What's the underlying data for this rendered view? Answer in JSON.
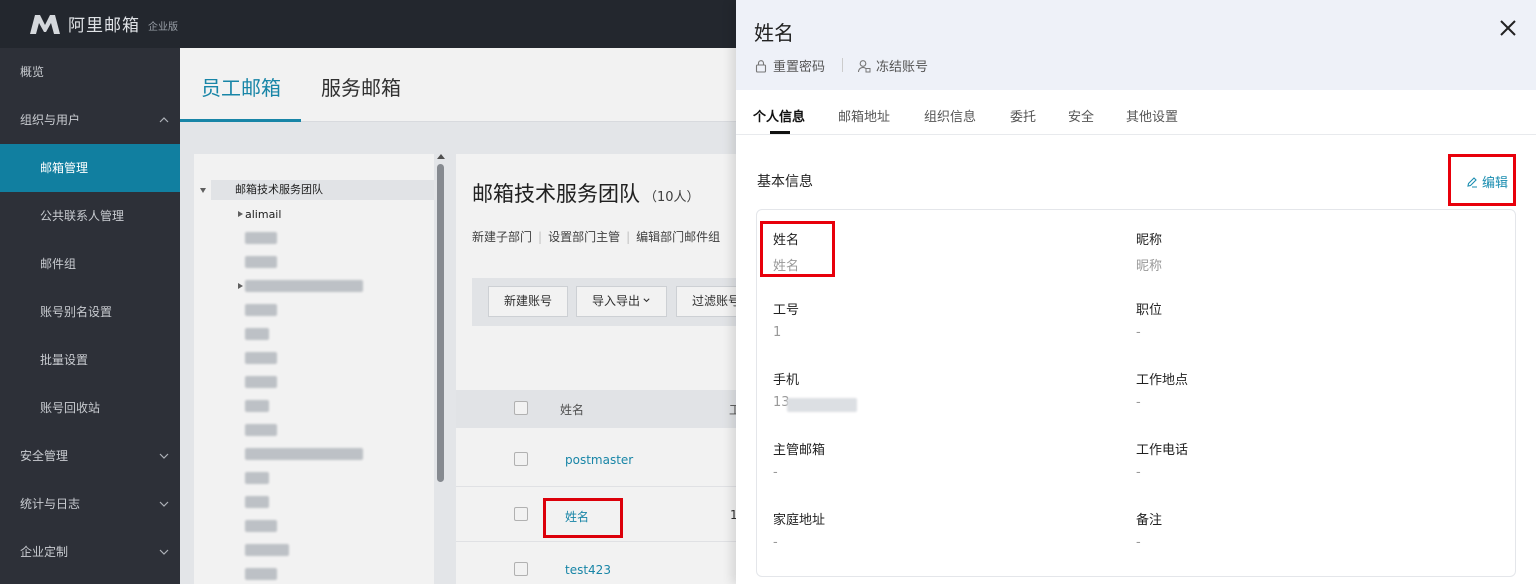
{
  "brand": {
    "name": "阿里邮箱",
    "edition": "企业版"
  },
  "sidebar": {
    "items": [
      {
        "label": "概览"
      },
      {
        "label": "组织与用户"
      },
      {
        "label": "邮箱管理"
      },
      {
        "label": "公共联系人管理"
      },
      {
        "label": "邮件组"
      },
      {
        "label": "账号别名设置"
      },
      {
        "label": "批量设置"
      },
      {
        "label": "账号回收站"
      },
      {
        "label": "安全管理"
      },
      {
        "label": "统计与日志"
      },
      {
        "label": "企业定制"
      }
    ]
  },
  "main": {
    "tabs": [
      {
        "label": "员工邮箱"
      },
      {
        "label": "服务邮箱"
      }
    ],
    "tree": {
      "root": "邮箱技术服务团队",
      "first_child": "alimail"
    },
    "dept": {
      "title": "邮箱技术服务团队",
      "count": "（10人）",
      "actions": [
        "新建子部门",
        "设置部门主管",
        "编辑部门邮件组"
      ]
    },
    "toolbar": {
      "new_account": "新建账号",
      "import_export": "导入导出",
      "filter": "过滤账号"
    },
    "table": {
      "name_header": "姓名",
      "col2_header": "工",
      "rows": [
        {
          "name": "postmaster",
          "col2": ""
        },
        {
          "name": "姓名",
          "col2": "1"
        },
        {
          "name": "test423",
          "col2": ""
        }
      ]
    }
  },
  "drawer": {
    "title": "姓名",
    "reset_password": "重置密码",
    "freeze_account": "冻结账号",
    "tabs": [
      {
        "label": "个人信息"
      },
      {
        "label": "邮箱地址"
      },
      {
        "label": "组织信息"
      },
      {
        "label": "委托"
      },
      {
        "label": "安全"
      },
      {
        "label": "其他设置"
      }
    ],
    "section_title": "基本信息",
    "edit_label": "编辑",
    "fields": [
      {
        "label": "姓名",
        "value": "姓名"
      },
      {
        "label": "昵称",
        "value": "昵称"
      },
      {
        "label": "工号",
        "value": "1"
      },
      {
        "label": "职位",
        "value": "-"
      },
      {
        "label": "手机",
        "value": "13"
      },
      {
        "label": "工作地点",
        "value": "-"
      },
      {
        "label": "主管邮箱",
        "value": "-"
      },
      {
        "label": "工作电话",
        "value": "-"
      },
      {
        "label": "家庭地址",
        "value": "-"
      },
      {
        "label": "备注",
        "value": "-"
      }
    ]
  },
  "colors": {
    "accent": "#1a8db0",
    "sidebar_active": "#117fa0",
    "highlight_box": "#e8000b"
  }
}
